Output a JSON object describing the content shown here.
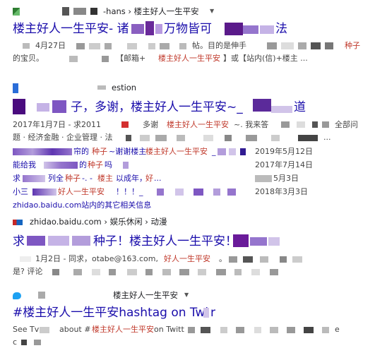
{
  "r1": {
    "url_text": "-hans › 楼主好人一生平安",
    "title_a": "楼主好人一生平安- 诸",
    "title_b": "万物皆可",
    "title_c": "法",
    "line1_date": "4月27日",
    "line1_mid": "帖。目的是伸手",
    "line1_hl": "种子",
    "line2_a": "的宝贝。",
    "line2_b": "【邮箱+",
    "line2_hl": "楼主好人一生平安",
    "line2_c": "】或【站内(信)+楼主 ..."
  },
  "r2": {
    "url_text": "estion",
    "title_a": "子，多谢，楼主好人一生平安~_",
    "title_b": "道",
    "line1_a": "2017年1月7日 - 求2011",
    "line1_b": "多谢",
    "line1_hl": "楼主好人一生平安",
    "line1_c": "~. 我来答",
    "line1_d": "全部问",
    "line2_a": "题 · 经济金融 · 企业管理 · 法",
    "line2_b": "...",
    "subs": [
      {
        "a": "",
        "b": "帘的",
        "hl": "种子",
        "c": "~谢谢楼主",
        "hl2": "楼主好人一生平安",
        "d": "_",
        "date": "2019年5月12日"
      },
      {
        "a": "能给我",
        "b": "的",
        "hl": "种子",
        "c": "吗",
        "hl2": "",
        "d": "",
        "date": "2017年7月14日"
      },
      {
        "a": "求",
        "b": "列全",
        "hl": "种子",
        "c": "-. - ",
        "hl2": "楼主",
        "d": "以成年，",
        "hl3": "好",
        "e": " ...",
        "date": "5月3日"
      },
      {
        "a": "小三",
        "b": "",
        "hl": "好人一生平安",
        "c": "！！！_",
        "hl2": "",
        "d": "",
        "date": "2018年3月3日"
      }
    ],
    "more_link": "zhidao.baidu.com站内的其它相关信息"
  },
  "r3": {
    "url_text": "zhidao.baidu.com › 娱乐休闲 › 动漫",
    "title_a": "求",
    "title_b": "种子！楼主好人一生平安！",
    "line1_a": "1月2日 - 同求，otabe@163.com, ",
    "line1_hl": "好人一生平安",
    "line1_b": "。",
    "line2_a": "是? 评论"
  },
  "r4": {
    "url_text": "楼主好人一生平安",
    "title_a": "#楼主好人一生平安hashtag on Twi",
    "title_b": "r",
    "line1_a": "See Tv",
    "line1_b": "about #",
    "line1_hl": "楼主好人一生平安",
    "line1_c": " on Twitt",
    "line1_d": "e",
    "line2_a": "c"
  }
}
